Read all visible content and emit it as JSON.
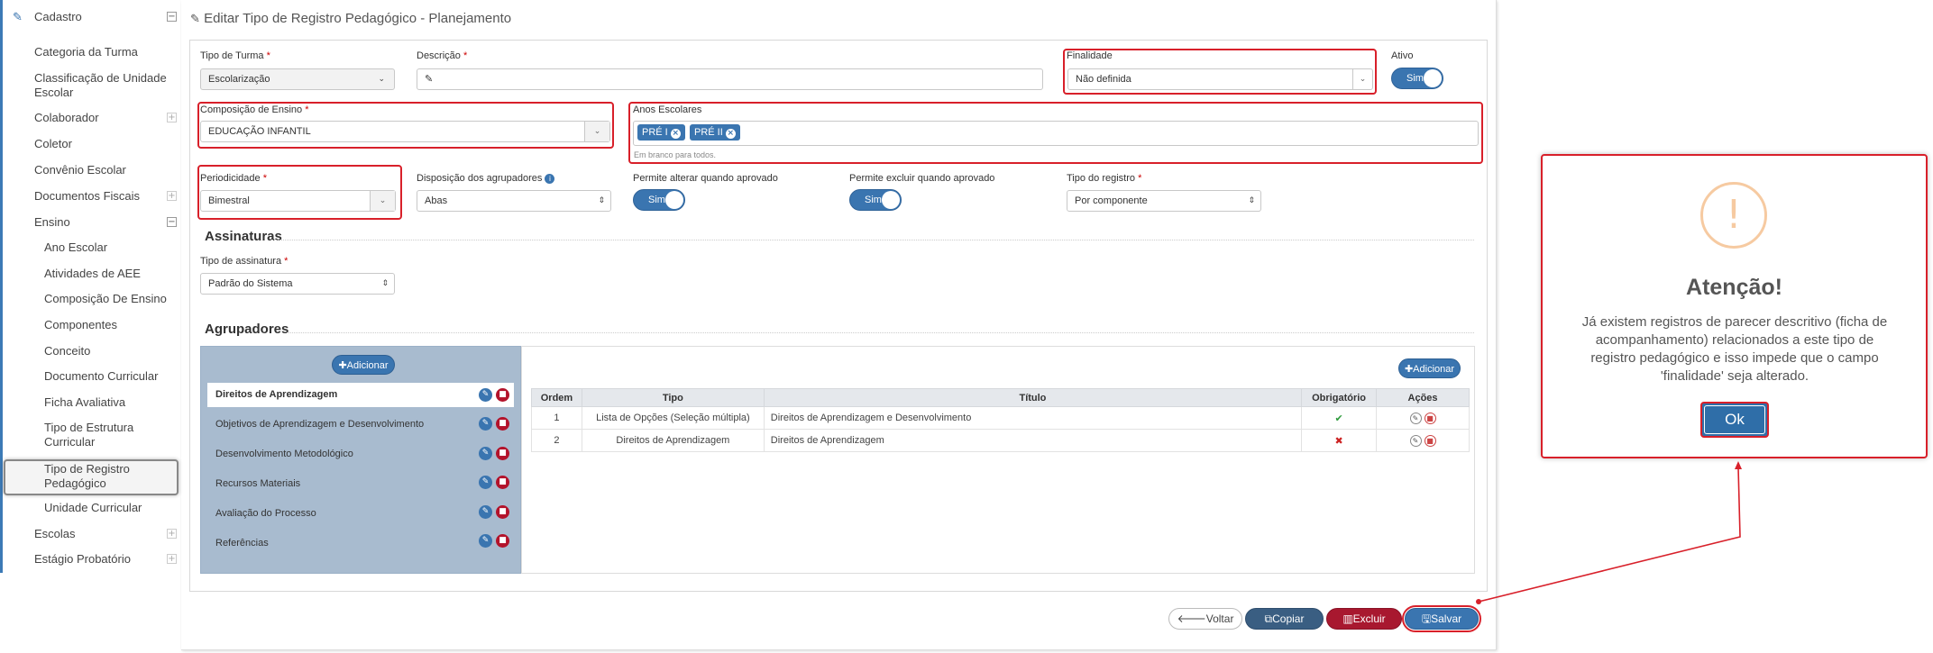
{
  "sidebar": {
    "cadastro": "Cadastro",
    "items": [
      {
        "label": "Categoria da Turma"
      },
      {
        "label": "Classificação de Unidade Escolar"
      },
      {
        "label": "Colaborador"
      },
      {
        "label": "Coletor"
      },
      {
        "label": "Convênio Escolar"
      },
      {
        "label": "Documentos Fiscais"
      },
      {
        "label": "Ensino"
      },
      {
        "label": "Ano Escolar"
      },
      {
        "label": "Atividades de AEE"
      },
      {
        "label": "Composição De Ensino"
      },
      {
        "label": "Componentes"
      },
      {
        "label": "Conceito"
      },
      {
        "label": "Documento Curricular"
      },
      {
        "label": "Ficha Avaliativa"
      },
      {
        "label": "Tipo de Estrutura Curricular"
      },
      {
        "label": "Tipo de Registro Pedagógico"
      },
      {
        "label": "Unidade Curricular"
      },
      {
        "label": "Escolas"
      },
      {
        "label": "Estágio Probatório"
      }
    ],
    "toggle_plus": "+",
    "toggle_minus": "−"
  },
  "page": {
    "title": "Editar Tipo de Registro Pedagógico - Planejamento"
  },
  "form": {
    "tipo_turma_label": "Tipo de Turma",
    "tipo_turma_value": "Escolarização",
    "descricao_label": "Descrição",
    "descricao_value": "",
    "finalidade_label": "Finalidade",
    "finalidade_value": "Não definida",
    "ativo_label": "Ativo",
    "ativo_value": "Sim",
    "composicao_label": "Composição de Ensino",
    "composicao_value": "EDUCAÇÃO INFANTIL",
    "anos_label": "Anos Escolares",
    "anos_tags": [
      "PRÉ I",
      "PRÉ II"
    ],
    "anos_help": "Em branco para todos.",
    "periodicidade_label": "Periodicidade",
    "periodicidade_value": "Bimestral",
    "disposicao_label": "Disposição dos agrupadores",
    "disposicao_value": "Abas",
    "permite_alterar_label": "Permite alterar quando aprovado",
    "permite_alterar_value": "Sim",
    "permite_excluir_label": "Permite excluir quando aprovado",
    "permite_excluir_value": "Sim",
    "tipo_registro_label": "Tipo do registro",
    "tipo_registro_value": "Por componente",
    "required_mark": "*"
  },
  "assinaturas": {
    "heading": "Assinaturas",
    "tipo_label": "Tipo de assinatura",
    "tipo_value": "Padrão do Sistema"
  },
  "agrupadores": {
    "heading": "Agrupadores",
    "add_label": "Adicionar",
    "groups": [
      "Direitos de Aprendizagem",
      "Objetivos de Aprendizagem e Desenvolvimento",
      "Desenvolvimento Metodológico",
      "Recursos Materiais",
      "Avaliação do Processo",
      "Referências"
    ],
    "table": {
      "headers": [
        "Ordem",
        "Tipo",
        "Título",
        "Obrigatório",
        "Ações"
      ],
      "rows": [
        {
          "ordem": "1",
          "tipo": "Lista de Opções (Seleção múltipla)",
          "titulo": "Direitos de Aprendizagem e Desenvolvimento",
          "obrigatorio": "✔"
        },
        {
          "ordem": "2",
          "tipo": "Direitos de Aprendizagem",
          "titulo": "Direitos de Aprendizagem",
          "obrigatorio": "✖"
        }
      ]
    }
  },
  "buttons": {
    "voltar": "Voltar",
    "copiar": "Copiar",
    "excluir": "Excluir",
    "salvar": "Salvar"
  },
  "modal": {
    "icon_glyph": "!",
    "title": "Atenção!",
    "message": "Já existem registros de parecer descritivo (ficha de acompanhamento) relacionados a este tipo de registro pedagógico e isso impede que o campo 'finalidade' seja alterado.",
    "ok": "Ok"
  },
  "colors": {
    "primary": "#3a75b0",
    "danger": "#a8182f",
    "highlight": "#d8202a",
    "warning": "#f6caa1"
  }
}
